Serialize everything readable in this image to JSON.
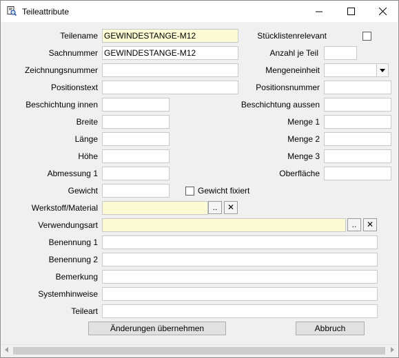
{
  "window": {
    "title": "Teileattribute",
    "icon": "search-document-icon"
  },
  "fields": {
    "teilename": {
      "label": "Teilename",
      "value": "GEWINDESTANGE-M12"
    },
    "sachnummer": {
      "label": "Sachnummer",
      "value": "GEWINDESTANGE-M12"
    },
    "zeichnungsnummer": {
      "label": "Zeichnungsnummer",
      "value": ""
    },
    "positionstext": {
      "label": "Positionstext",
      "value": ""
    },
    "beschichtung_innen": {
      "label": "Beschichtung innen",
      "value": ""
    },
    "breite": {
      "label": "Breite",
      "value": ""
    },
    "laenge": {
      "label": "Länge",
      "value": ""
    },
    "hoehe": {
      "label": "Höhe",
      "value": ""
    },
    "abmessung1": {
      "label": "Abmessung 1",
      "value": ""
    },
    "gewicht": {
      "label": "Gewicht",
      "value": ""
    },
    "werkstoff": {
      "label": "Werkstoff/Material",
      "value": ""
    },
    "verwendungsart": {
      "label": "Verwendungsart",
      "value": ""
    },
    "benennung1": {
      "label": "Benennung 1",
      "value": ""
    },
    "benennung2": {
      "label": "Benennung 2",
      "value": ""
    },
    "bemerkung": {
      "label": "Bemerkung",
      "value": ""
    },
    "systemhinweise": {
      "label": "Systemhinweise",
      "value": ""
    },
    "teileart": {
      "label": "Teileart",
      "value": ""
    },
    "stuecklistenrelevant": {
      "label": "Stücklistenrelevant",
      "checked": false
    },
    "anzahl_je_teil": {
      "label": "Anzahl je Teil",
      "value": ""
    },
    "mengeneinheit": {
      "label": "Mengeneinheit",
      "value": ""
    },
    "positionsnummer": {
      "label": "Positionsnummer",
      "value": ""
    },
    "beschichtung_aussen": {
      "label": "Beschichtung aussen",
      "value": ""
    },
    "menge1": {
      "label": "Menge 1",
      "value": ""
    },
    "menge2": {
      "label": "Menge 2",
      "value": ""
    },
    "menge3": {
      "label": "Menge 3",
      "value": ""
    },
    "oberflaeche": {
      "label": "Oberfläche",
      "value": ""
    },
    "gewicht_fixiert": {
      "label": "Gewicht fixiert",
      "checked": false
    }
  },
  "small_buttons": {
    "browse": "..",
    "clear": "✕"
  },
  "buttons": {
    "apply": "Änderungen übernehmen",
    "cancel": "Abbruch"
  },
  "colors": {
    "required_field": "#fdfbd4",
    "dialog_bg": "#f0f0f0"
  }
}
